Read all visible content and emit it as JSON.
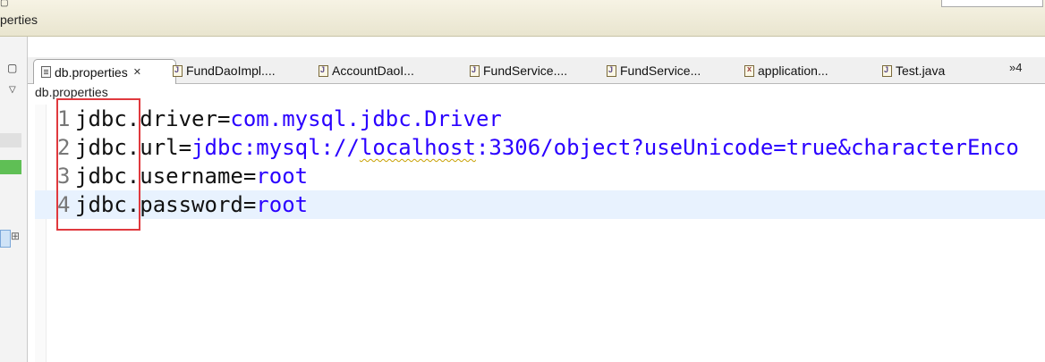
{
  "window": {
    "crumb_partial": "perties"
  },
  "tabs": [
    {
      "label": "db.properties",
      "icon": "properties-file-icon",
      "active": true,
      "close": "✕"
    },
    {
      "label": "FundDaoImpl....",
      "icon": "java-file-icon"
    },
    {
      "label": "AccountDaoI...",
      "icon": "java-file-icon"
    },
    {
      "label": "FundService....",
      "icon": "java-file-icon"
    },
    {
      "label": "FundService...",
      "icon": "java-file-icon"
    },
    {
      "label": "application...",
      "icon": "xml-file-icon"
    },
    {
      "label": "Test.java",
      "icon": "java-file-icon"
    }
  ],
  "tab_overflow": "»4",
  "editor": {
    "breadcrumb": "db.properties",
    "lines": [
      {
        "num": "1",
        "key": "jdbc.driver",
        "eq": "=",
        "value": "com.mysql.jdbc.Driver"
      },
      {
        "num": "2",
        "key": "jdbc.url",
        "eq": "=",
        "value_a": "jdbc:mysql://",
        "value_b": "localhost",
        "value_c": ":3306/object?useUnicode=true&characterEnco"
      },
      {
        "num": "3",
        "key": "jdbc.username",
        "eq": "=",
        "value": "root"
      },
      {
        "num": "4",
        "key": "jdbc.password",
        "eq": "=",
        "value": "root"
      }
    ]
  },
  "colors": {
    "key": "#111111",
    "value": "#2a00ff",
    "highlight_line": "#e8f2fe",
    "annotation_box": "#e0393e"
  }
}
